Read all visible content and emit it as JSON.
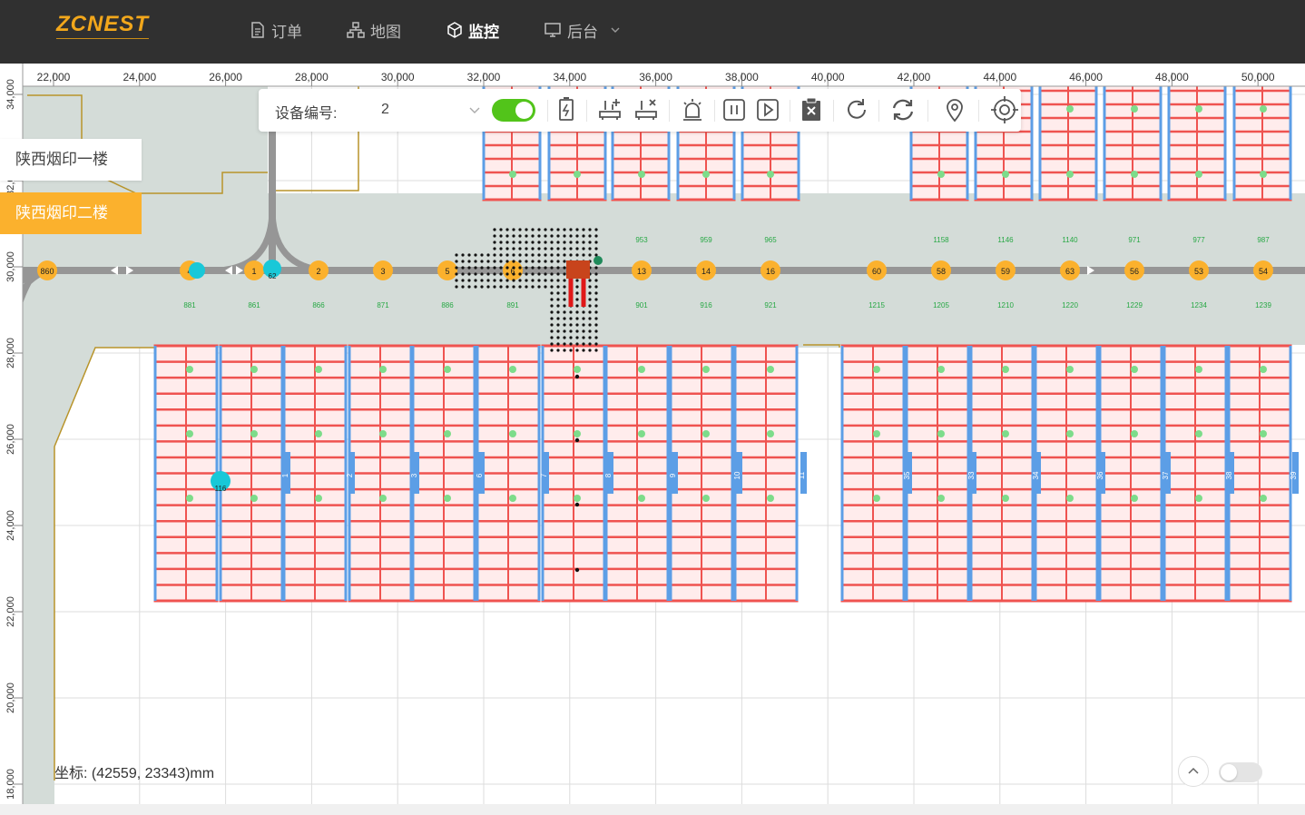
{
  "app": {
    "logo": "ZCNEST"
  },
  "nav": {
    "items": [
      {
        "label": "订单",
        "icon": "document-icon"
      },
      {
        "label": "地图",
        "icon": "sitemap-icon"
      },
      {
        "label": "监控",
        "icon": "cube-icon",
        "active": true
      },
      {
        "label": "后台",
        "icon": "monitor-icon",
        "has_dropdown": true
      }
    ]
  },
  "toolbar": {
    "device_label": "设备编号:",
    "device_value": "2",
    "enabled": true,
    "icons": [
      "battery-charge-icon",
      "add-vehicle-icon",
      "remove-vehicle-icon",
      "alarm-icon",
      "pause-icon",
      "play-icon",
      "clear-task-icon",
      "refresh-icon",
      "sync-icon",
      "location-pin-icon",
      "target-icon"
    ]
  },
  "floors": {
    "items": [
      "陕西烟印一楼",
      "陕西烟印二楼"
    ],
    "active_index": 1
  },
  "coordinate": {
    "text": "坐标:  (42559, 23343)mm"
  },
  "ruler": {
    "x_labels": [
      "22,000",
      "24,000",
      "26,000",
      "28,000",
      "30,000",
      "32,000",
      "34,000",
      "36,000",
      "38,000",
      "40,000",
      "42,000",
      "44,000",
      "46,000",
      "48,000",
      "50,000"
    ],
    "y_labels": [
      "34,000",
      "32,000",
      "30,000",
      "28,000",
      "26,000",
      "24,000",
      "22,000",
      "20,000",
      "18,000"
    ]
  },
  "path_nodes": {
    "labels": [
      "860",
      "4",
      "1",
      "2",
      "3",
      "5",
      "6",
      "13",
      "14",
      "16",
      "60",
      "58",
      "59",
      "63",
      "56",
      "53",
      "54",
      "62"
    ],
    "aisle_upper": [
      "953",
      "959",
      "965",
      "1158",
      "1146",
      "1140",
      "971",
      "977",
      "987"
    ],
    "aisle_lower": [
      "881",
      "861",
      "866",
      "871",
      "886",
      "891",
      "901",
      "916",
      "921",
      "1215",
      "1205",
      "1210",
      "1220",
      "1229",
      "1234",
      "1239"
    ]
  },
  "rack_ids": [
    "1",
    "2",
    "3",
    "6",
    "7",
    "8",
    "9",
    "10",
    "11",
    "35",
    "33",
    "34",
    "36",
    "37",
    "38",
    "39",
    "116"
  ],
  "colors": {
    "topbar": "#303030",
    "accent": "#fbb12d",
    "rack": "#ef5350",
    "rack_border": "#5c9ee6",
    "active_toggle": "#52c41a",
    "aisle": "#d4dcd8",
    "road": "#969696"
  }
}
